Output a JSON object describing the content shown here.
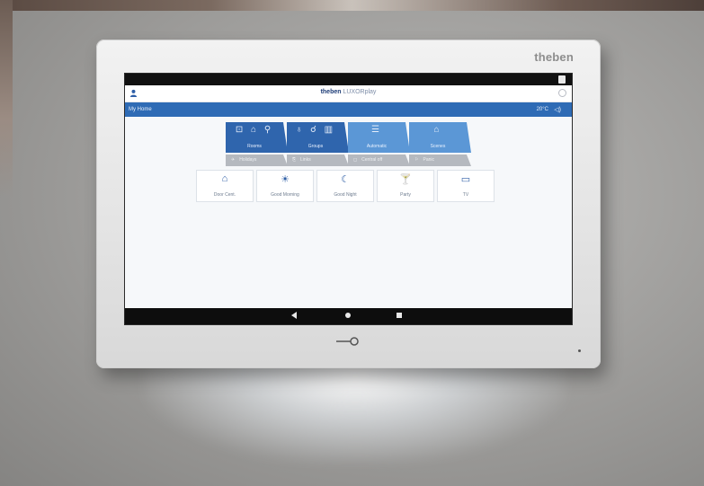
{
  "device": {
    "brand": "theben"
  },
  "app": {
    "title_brand": "theben",
    "title_product": "LUXORplay"
  },
  "homebar": {
    "label": "My Home",
    "temperature": "20°C"
  },
  "tiles": [
    {
      "label": "Rooms",
      "icons": "⊡ ⌂ ⚲"
    },
    {
      "label": "Groups",
      "icons": "♁ ☌ ▥"
    },
    {
      "label": "Automatic",
      "icons": "☰"
    },
    {
      "label": "Scenes",
      "icons": "⌂"
    }
  ],
  "subtiles": [
    {
      "label": "Holidays",
      "icon": "✈"
    },
    {
      "label": "Links",
      "icon": "⎘"
    },
    {
      "label": "Central off",
      "icon": "◻"
    },
    {
      "label": "Panic",
      "icon": "⚐"
    }
  ],
  "scenes": [
    {
      "label": "Door Cent.",
      "icon": "⌂"
    },
    {
      "label": "Good Morning",
      "icon": "☀"
    },
    {
      "label": "Good Night",
      "icon": "☾"
    },
    {
      "label": "Party",
      "icon": "🍸"
    },
    {
      "label": "TV",
      "icon": "▭"
    }
  ],
  "colors": {
    "header_blue": "#2e6bb5",
    "tile_dark": "#2f65ad",
    "tile_light": "#5b97d6",
    "subtile_gray": "#b5b9bf"
  }
}
